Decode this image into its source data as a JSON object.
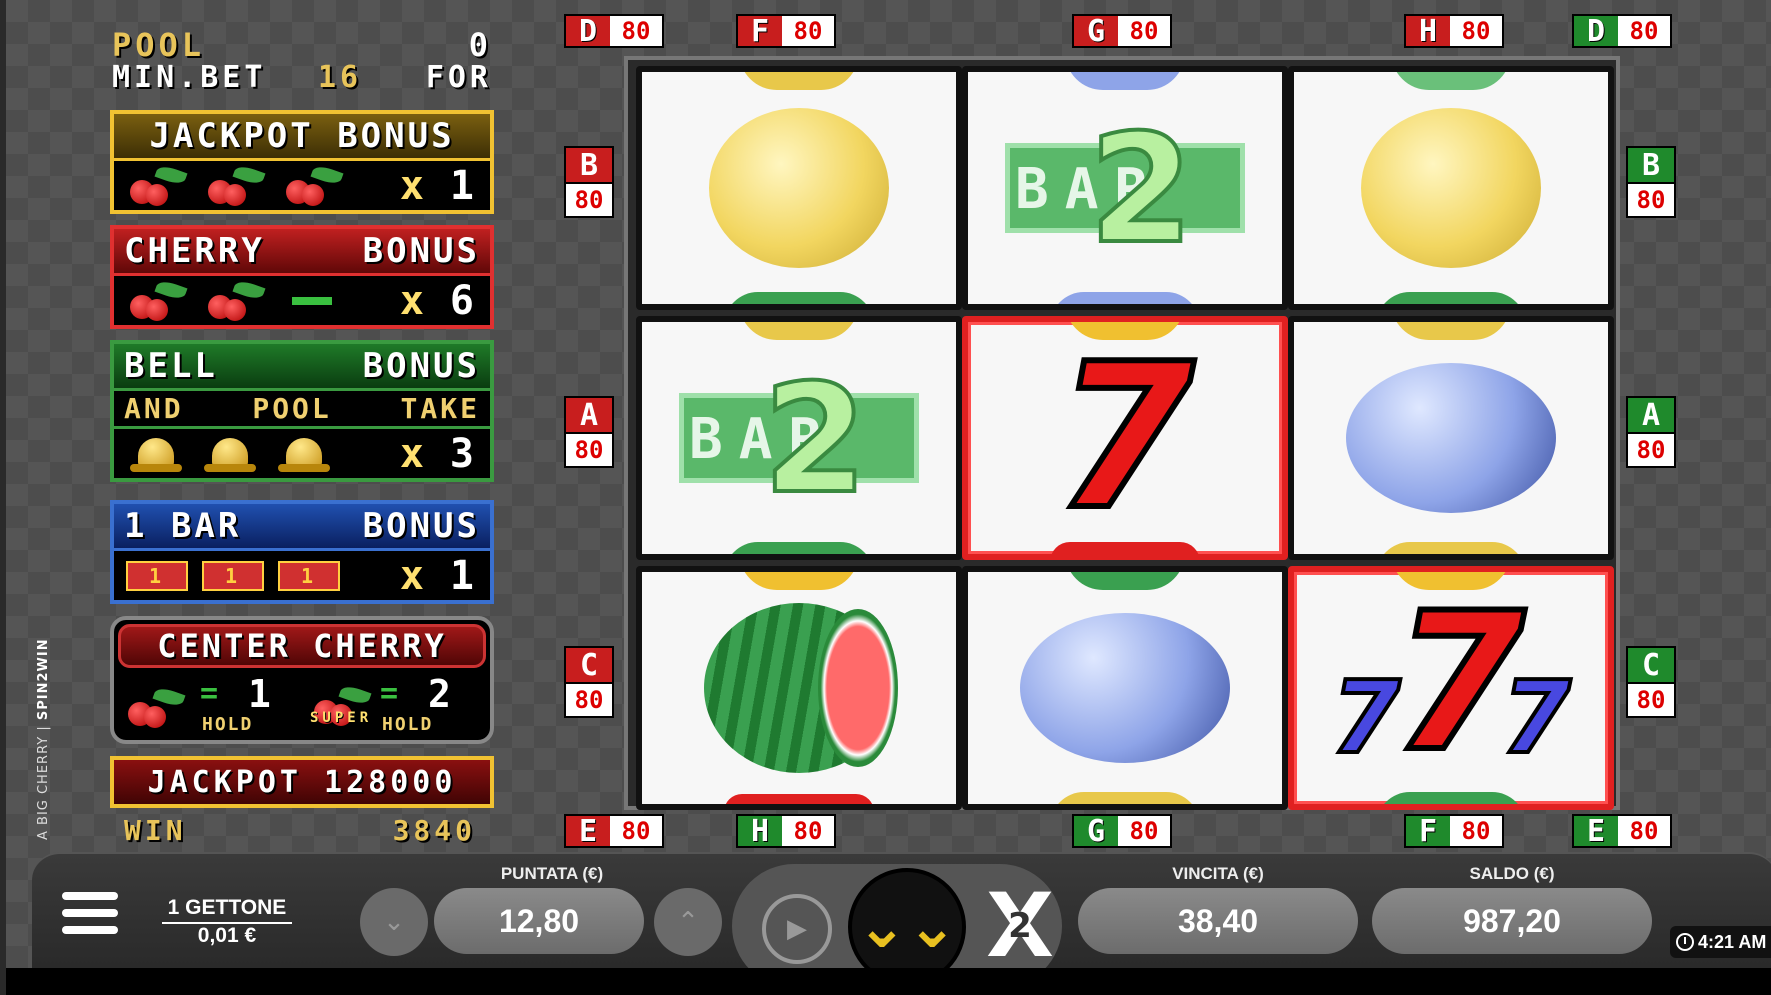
{
  "pool": {
    "label": "POOL",
    "value": "0"
  },
  "min_bet": {
    "label": "MIN.BET",
    "value": "16",
    "suffix": "FOR"
  },
  "bonuses": {
    "jackpot": {
      "title": "JACKPOT BONUS",
      "x": "x",
      "mult": "1"
    },
    "cherry": {
      "title_left": "CHERRY",
      "title_right": "BONUS",
      "x": "x",
      "mult": "6"
    },
    "bell": {
      "title_left": "BELL",
      "title_right": "BONUS",
      "sub": [
        "AND",
        "POOL",
        "TAKE"
      ],
      "x": "x",
      "mult": "3"
    },
    "bar": {
      "title_left": "1 BAR",
      "title_right": "BONUS",
      "bar_label": "1",
      "x": "x",
      "mult": "1"
    }
  },
  "center_cherry": {
    "title": "CENTER CHERRY",
    "normal": {
      "eq": "=",
      "value": "1",
      "hold": "HOLD"
    },
    "super": {
      "badge": "SUPER",
      "eq": "=",
      "value": "2",
      "hold": "HOLD"
    }
  },
  "jackpot": {
    "label": "JACKPOT 128000"
  },
  "win": {
    "label": "WIN",
    "value": "3840"
  },
  "brand": {
    "game": "A BIG CHERRY",
    "provider": "SPIN2WIN"
  },
  "lines": {
    "top": [
      {
        "letter": "D",
        "value": "80",
        "color": "red"
      },
      {
        "letter": "F",
        "value": "80",
        "color": "red"
      },
      {
        "letter": "G",
        "value": "80",
        "color": "red"
      },
      {
        "letter": "H",
        "value": "80",
        "color": "red"
      },
      {
        "letter": "D",
        "value": "80",
        "color": "green"
      }
    ],
    "bottom": [
      {
        "letter": "E",
        "value": "80",
        "color": "red"
      },
      {
        "letter": "H",
        "value": "80",
        "color": "green"
      },
      {
        "letter": "G",
        "value": "80",
        "color": "green"
      },
      {
        "letter": "F",
        "value": "80",
        "color": "green"
      },
      {
        "letter": "E",
        "value": "80",
        "color": "green"
      }
    ],
    "left": [
      {
        "letter": "B",
        "value": "80",
        "color": "red"
      },
      {
        "letter": "A",
        "value": "80",
        "color": "red"
      },
      {
        "letter": "C",
        "value": "80",
        "color": "red"
      }
    ],
    "right": [
      {
        "letter": "B",
        "value": "80",
        "color": "green"
      },
      {
        "letter": "A",
        "value": "80",
        "color": "green"
      },
      {
        "letter": "C",
        "value": "80",
        "color": "green"
      }
    ]
  },
  "reels": {
    "row1": [
      "lemon",
      "bar-2",
      "lemon"
    ],
    "row2": [
      "bar-2",
      "red-seven",
      "plum"
    ],
    "row3": [
      "watermelon",
      "plum",
      "triple-seven"
    ],
    "highlighted": [
      "row2-col2",
      "row3-col3"
    ],
    "seven_glyph": "7",
    "bar_text": "BAR",
    "bar_number": "2"
  },
  "controls": {
    "coin": {
      "label": "1 GETTONE",
      "value": "0,01 €"
    },
    "bet": {
      "caption": "PUNTATA (€)",
      "value": "12,80"
    },
    "win": {
      "caption": "VINCITA (€)",
      "value": "38,40"
    },
    "balance": {
      "caption": "SALDO (€)",
      "value": "987,20"
    },
    "x2": {
      "glyph": "X",
      "number": "2"
    },
    "spin_glyph": "⌄⌄",
    "autoplay_glyph": "▶",
    "bet_down_glyph": "⌄",
    "bet_up_glyph": "⌃"
  },
  "clock": {
    "time": "4:21 AM"
  },
  "colors": {
    "line_red": "#c81e1e",
    "line_green": "#1f8a2c",
    "spin_accent": "#e8c020",
    "win_highlight": "#e02020"
  }
}
